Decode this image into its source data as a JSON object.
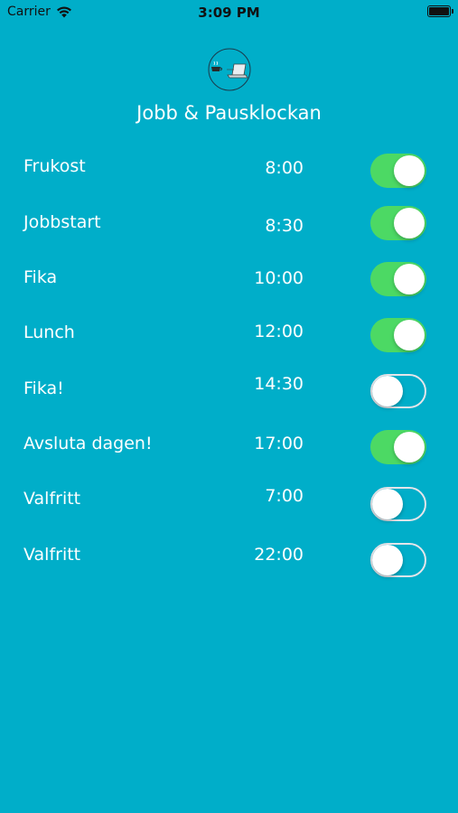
{
  "status_bar": {
    "carrier": "Carrier",
    "time": "3:09 PM"
  },
  "app": {
    "title": "Jobb & Pausklockan",
    "logo_icon": "coffee-laptop-icon"
  },
  "colors": {
    "background": "#00aec9",
    "toggle_on": "#4cd964",
    "toggle_off_border": "#e5e5ea"
  },
  "alarms": [
    {
      "label": "Frukost",
      "time": "8:00",
      "enabled": true
    },
    {
      "label": "Jobbstart",
      "time": "8:30",
      "enabled": true
    },
    {
      "label": "Fika",
      "time": "10:00",
      "enabled": true
    },
    {
      "label": "Lunch",
      "time": "12:00",
      "enabled": true
    },
    {
      "label": "Fika!",
      "time": "14:30",
      "enabled": false
    },
    {
      "label": "Avsluta dagen!",
      "time": "17:00",
      "enabled": true
    },
    {
      "label": "Valfritt",
      "time": "7:00",
      "enabled": false
    },
    {
      "label": "Valfritt",
      "time": "22:00",
      "enabled": false
    }
  ]
}
